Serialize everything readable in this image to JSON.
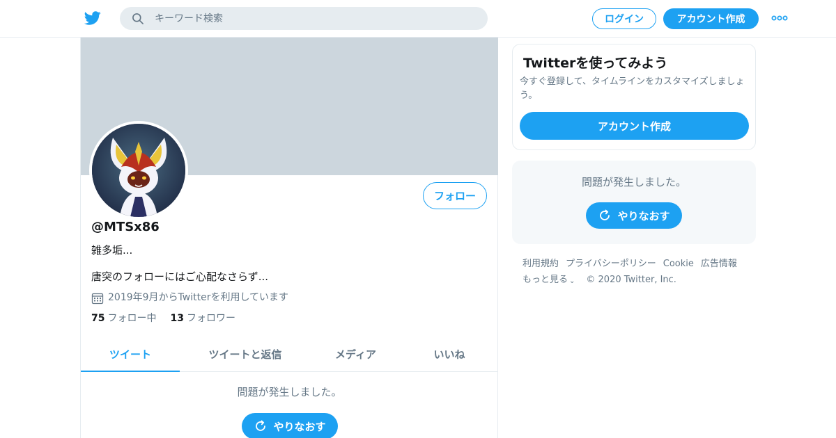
{
  "header": {
    "search_placeholder": "キーワード検索",
    "login_label": "ログイン",
    "signup_label": "アカウント作成",
    "brand_color": "#1da1f2"
  },
  "profile": {
    "handle": "@MTSx86",
    "name": "雑多垢...",
    "bio": "唐突のフォローにはご心配なさらず...",
    "joined": "2019年9月からTwitterを利用しています",
    "follow_label": "フォロー",
    "following_count": "75",
    "following_label": "フォロー中",
    "followers_count": "13",
    "followers_label": "フォロワー"
  },
  "tabs": [
    {
      "label": "ツイート",
      "active": true
    },
    {
      "label": "ツイートと返信",
      "active": false
    },
    {
      "label": "メディア",
      "active": false
    },
    {
      "label": "いいね",
      "active": false
    }
  ],
  "timeline": {
    "error_text": "問題が発生しました。",
    "retry_label": "やりなおす"
  },
  "sidebar": {
    "signup_card": {
      "title": "Twitterを使ってみよう",
      "description": "今すぐ登録して、タイムラインをカスタマイズしましょう。",
      "button_label": "アカウント作成"
    },
    "error_card": {
      "error_text": "問題が発生しました。",
      "retry_label": "やりなおす"
    },
    "footer": {
      "links": [
        "利用規約",
        "プライバシーポリシー",
        "Cookie",
        "広告情報"
      ],
      "more_label": "もっと見る",
      "copyright": "© 2020 Twitter, Inc."
    }
  }
}
